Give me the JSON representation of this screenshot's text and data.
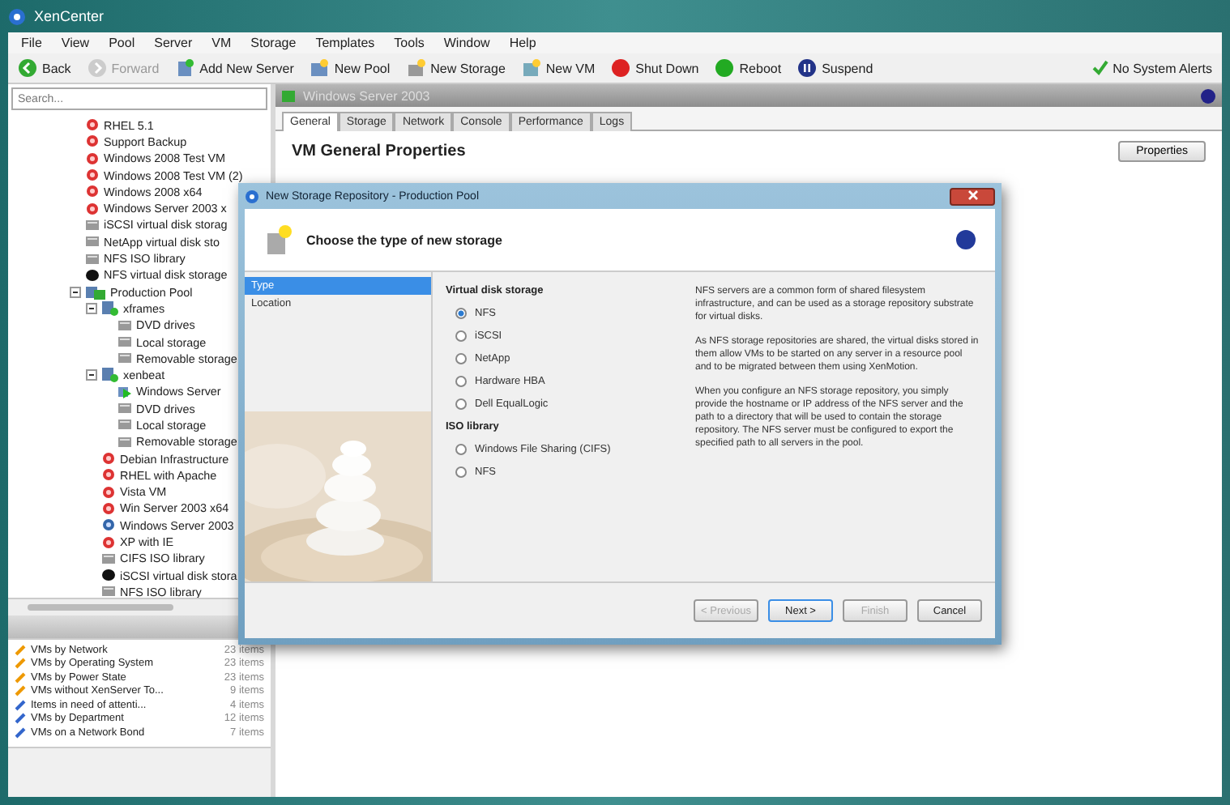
{
  "window": {
    "title": "XenCenter"
  },
  "menu": [
    "File",
    "View",
    "Pool",
    "Server",
    "VM",
    "Storage",
    "Templates",
    "Tools",
    "Window",
    "Help"
  ],
  "toolbar": [
    {
      "label": "Back",
      "kind": "back",
      "disabled": false
    },
    {
      "label": "Forward",
      "kind": "forward",
      "disabled": true
    },
    {
      "label": "Add New Server",
      "kind": "server"
    },
    {
      "label": "New Pool",
      "kind": "pool"
    },
    {
      "label": "New Storage",
      "kind": "storage"
    },
    {
      "label": "New VM",
      "kind": "vm"
    },
    {
      "label": "Shut Down",
      "kind": "shutdown"
    },
    {
      "label": "Reboot",
      "kind": "reboot"
    },
    {
      "label": "Suspend",
      "kind": "suspend"
    }
  ],
  "alerts": "No System Alerts",
  "search": {
    "placeholder": "Search..."
  },
  "tree": [
    {
      "label": "RHEL 5.1",
      "kind": "halted-vm"
    },
    {
      "label": "Support Backup",
      "kind": "halted-vm"
    },
    {
      "label": "Windows 2008 Test VM",
      "kind": "halted-vm"
    },
    {
      "label": "Windows 2008 Test VM (2)",
      "kind": "halted-vm"
    },
    {
      "label": "Windows 2008 x64",
      "kind": "halted-vm"
    },
    {
      "label": "Windows Server 2003 x",
      "kind": "halted-vm"
    },
    {
      "label": "iSCSI virtual disk storag",
      "kind": "storage"
    },
    {
      "label": "NetApp virtual disk sto",
      "kind": "storage"
    },
    {
      "label": "NFS ISO library",
      "kind": "storage"
    },
    {
      "label": "NFS virtual disk storage",
      "kind": "default-storage"
    },
    {
      "label": "Production Pool",
      "kind": "pool",
      "expanded": true,
      "children": [
        {
          "label": "xframes",
          "kind": "server",
          "expanded": true,
          "children": [
            {
              "label": "DVD drives",
              "kind": "storage"
            },
            {
              "label": "Local storage",
              "kind": "storage"
            },
            {
              "label": "Removable storage",
              "kind": "storage"
            }
          ]
        },
        {
          "label": "xenbeat",
          "kind": "server",
          "expanded": true,
          "children": [
            {
              "label": "Windows Server",
              "kind": "running-vm"
            },
            {
              "label": "DVD drives",
              "kind": "storage"
            },
            {
              "label": "Local storage",
              "kind": "storage"
            },
            {
              "label": "Removable storage",
              "kind": "storage"
            }
          ]
        },
        {
          "label": "Debian Infrastructure",
          "kind": "halted-vm"
        },
        {
          "label": "RHEL with Apache",
          "kind": "halted-vm"
        },
        {
          "label": "Vista VM",
          "kind": "halted-vm"
        },
        {
          "label": "Win Server 2003 x64",
          "kind": "halted-vm"
        },
        {
          "label": "Windows Server 2003",
          "kind": "suspended-vm"
        },
        {
          "label": "XP with IE",
          "kind": "halted-vm"
        },
        {
          "label": "CIFS ISO library",
          "kind": "storage"
        },
        {
          "label": "iSCSI virtual disk stora",
          "kind": "default-storage"
        },
        {
          "label": "NFS ISO library",
          "kind": "storage"
        }
      ]
    }
  ],
  "saved_searches": [
    {
      "label": "VMs by Network",
      "count": "23 items",
      "kind": "system"
    },
    {
      "label": "VMs by Operating System",
      "count": "23 items",
      "kind": "system"
    },
    {
      "label": "VMs by Power State",
      "count": "23 items",
      "kind": "system"
    },
    {
      "label": "VMs without XenServer To...",
      "count": "9 items",
      "kind": "system"
    },
    {
      "label": "Items in need of attenti...",
      "count": "4 items",
      "kind": "user"
    },
    {
      "label": "VMs by Department",
      "count": "12 items",
      "kind": "user"
    },
    {
      "label": "VMs on a Network Bond",
      "count": "7 items",
      "kind": "user"
    }
  ],
  "panel": {
    "title": "Windows Server 2003",
    "tabs": [
      {
        "label": "General",
        "selected": true
      },
      {
        "label": "Storage",
        "selected": false
      },
      {
        "label": "Network",
        "selected": false
      },
      {
        "label": "Console",
        "selected": false
      },
      {
        "label": "Performance",
        "selected": false
      },
      {
        "label": "Logs",
        "selected": false
      }
    ],
    "heading": "VM General Properties",
    "button": "Properties"
  },
  "dialog": {
    "title": "New Storage Repository - Production Pool",
    "heading": "Choose the type of new storage",
    "steps": [
      {
        "label": "Type",
        "selected": true
      },
      {
        "label": "Location",
        "selected": false
      }
    ],
    "groups": [
      {
        "title": "Virtual disk storage",
        "options": [
          {
            "label": "NFS",
            "selected": true
          },
          {
            "label": "iSCSI",
            "selected": false
          },
          {
            "label": "NetApp",
            "selected": false
          },
          {
            "label": "Hardware HBA",
            "selected": false
          },
          {
            "label": "Dell EqualLogic",
            "selected": false
          }
        ]
      },
      {
        "title": "ISO library",
        "options": [
          {
            "label": "Windows File Sharing (CIFS)",
            "selected": false
          },
          {
            "label": "NFS",
            "selected": false
          }
        ]
      }
    ],
    "description": [
      "NFS servers are a common form of shared filesystem infrastructure, and can be used as a storage repository substrate for virtual disks.",
      "As NFS storage repositories are shared, the virtual disks stored in them allow VMs to be started on any server in a resource pool and to be migrated between them using XenMotion.",
      "When you configure an NFS storage repository, you simply provide the hostname or IP address of the NFS server and the path to a directory that will be used to contain the storage repository. The NFS server must be configured to export the specified path to all servers in the pool."
    ],
    "buttons": [
      {
        "label": "< Previous",
        "disabled": true,
        "default": false
      },
      {
        "label": "Next >",
        "disabled": false,
        "default": true
      },
      {
        "label": "Finish",
        "disabled": true,
        "default": false
      },
      {
        "label": "Cancel",
        "disabled": false,
        "default": false
      }
    ]
  }
}
